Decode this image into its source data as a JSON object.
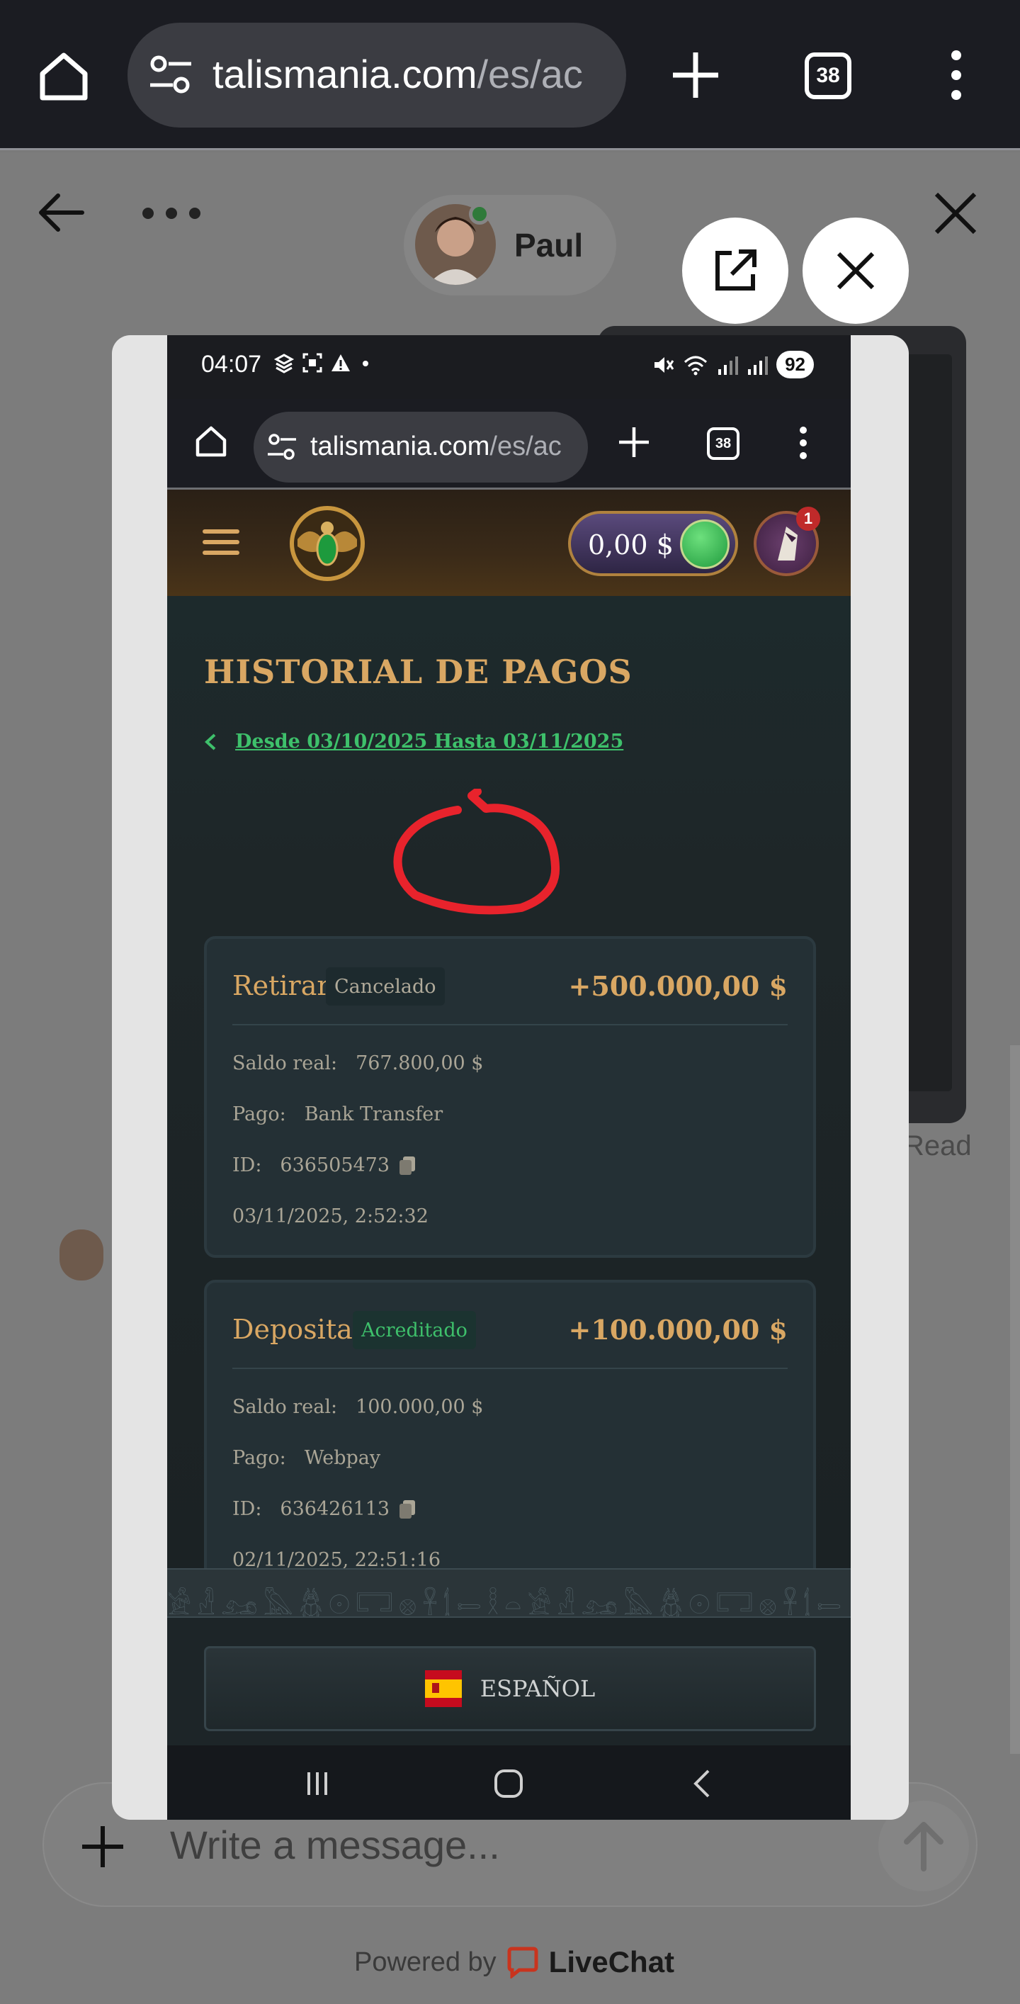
{
  "browser": {
    "url_domain": "talismania.com",
    "url_path": "/es/ac",
    "tab_count": "38"
  },
  "livechat": {
    "agent_name": "Paul",
    "read_label": "Read",
    "message_placeholder": "Write a message...",
    "powered_by": "Powered by",
    "brand": "LiveChat"
  },
  "screenshot": {
    "status_time": "04:07",
    "battery": "92",
    "url_domain": "talismania.com",
    "url_path": "/es/ac",
    "tab_count": "38",
    "balance": "0,00 $",
    "notification_count": "1",
    "page_title": "HISTORIAL DE PAGOS",
    "date_range": "Desde 03/10/2025 Hasta 03/11/2025",
    "transactions": [
      {
        "type": "Retirar",
        "status": "Cancelado",
        "amount": "+500.000,00 $",
        "saldo_label": "Saldo real:",
        "saldo_value": "767.800,00 $",
        "pago_label": "Pago:",
        "pago_value": "Bank Transfer",
        "id_label": "ID:",
        "id_value": "636505473",
        "datetime": "03/11/2025, 2:52:32"
      },
      {
        "type": "Deposita",
        "status": "Acreditado",
        "amount": "+100.000,00 $",
        "saldo_label": "Saldo real:",
        "saldo_value": "100.000,00 $",
        "pago_label": "Pago:",
        "pago_value": "Webpay",
        "id_label": "ID:",
        "id_value": "636426113",
        "datetime": "02/11/2025, 22:51:16"
      }
    ],
    "language": "ESPAÑOL"
  },
  "colors": {
    "gold": "#d9a763",
    "green": "#3ec06b",
    "annotation_red": "#e8232c"
  }
}
